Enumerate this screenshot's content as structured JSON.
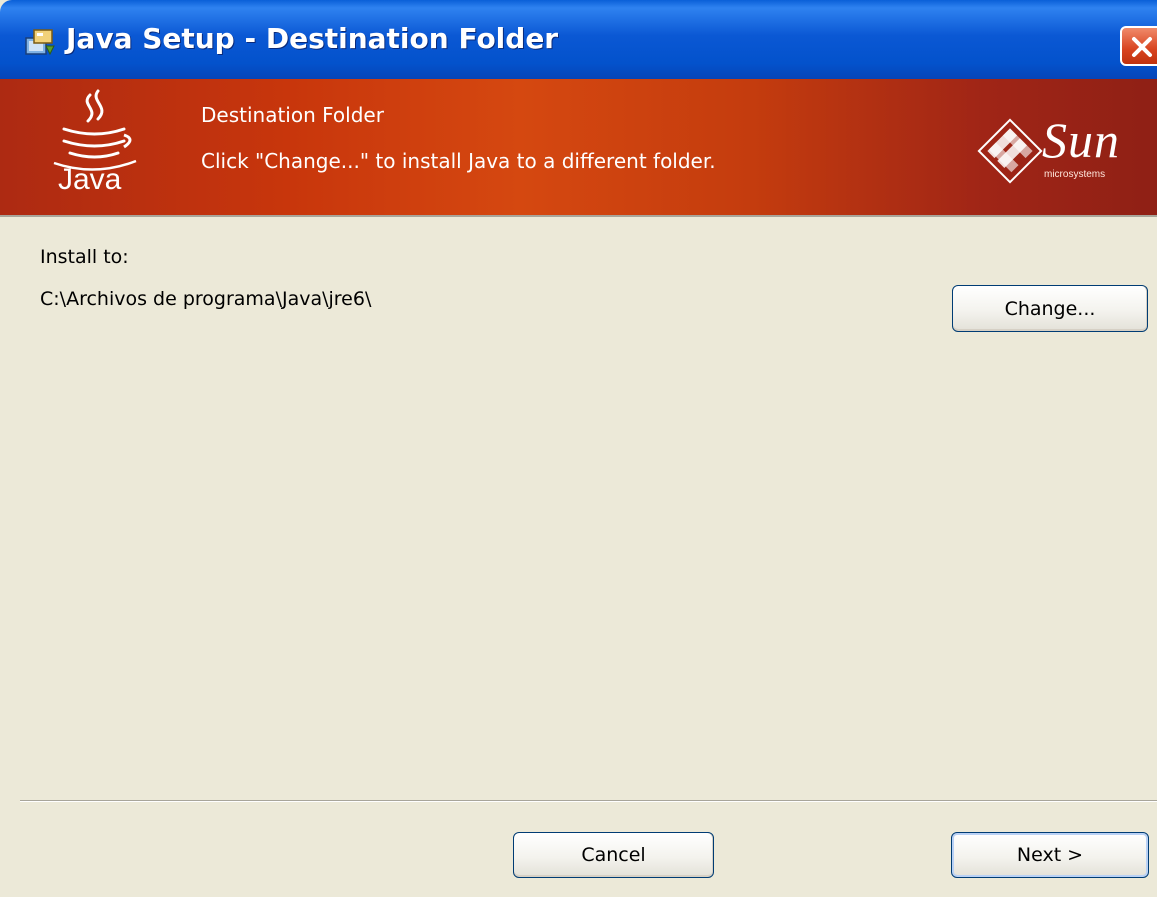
{
  "window": {
    "title": "Java Setup - Destination Folder"
  },
  "banner": {
    "title": "Destination Folder",
    "subtitle": "Click \"Change...\" to install Java to a different folder.",
    "java_logo_text": "Java",
    "sun_logo_text": "Sun",
    "sun_logo_subtext": "microsystems",
    "background_color": "#c8360c"
  },
  "content": {
    "install_label": "Install to:",
    "install_path": "C:\\Archivos de programa\\Java\\jre6\\",
    "change_button": "Change..."
  },
  "footer": {
    "cancel_button": "Cancel",
    "next_button": "Next >"
  },
  "icons": {
    "title_icon": "installer-icon",
    "close_icon": "close-icon",
    "java_logo": "java-cup-icon",
    "sun_logo": "sun-diamond-icon"
  }
}
